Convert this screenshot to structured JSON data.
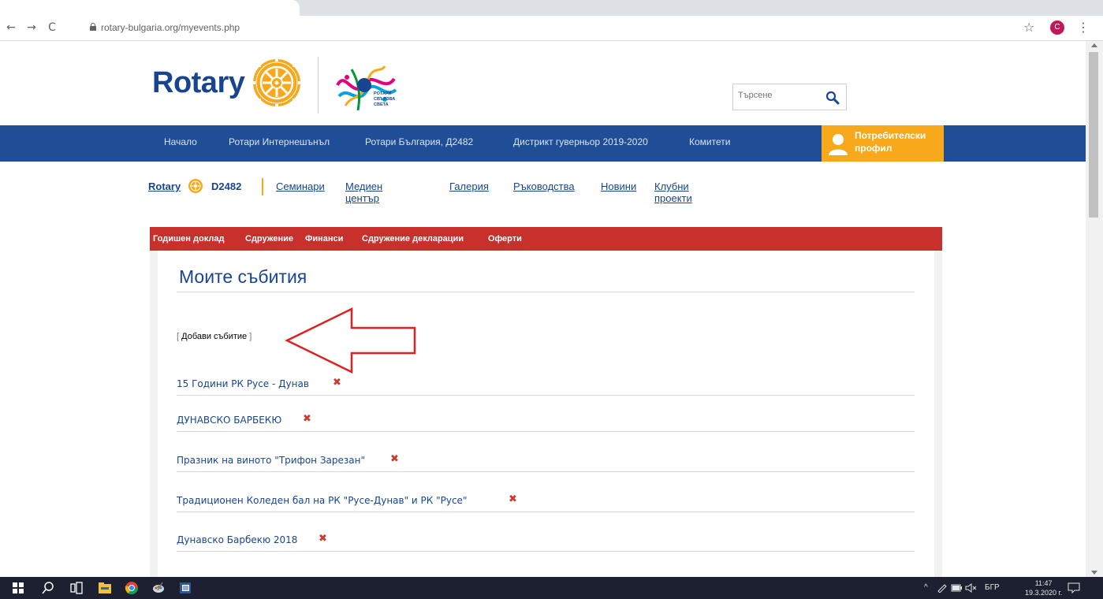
{
  "browser": {
    "url": "rotary-bulgaria.org/myevents.php",
    "profile_initial": "C"
  },
  "header": {
    "logo_text": "Rotary",
    "connect_logo_text": [
      "РОТАРИ",
      "СВЪРЗВА",
      "СВЕТА"
    ],
    "search_placeholder": "Търсене"
  },
  "main_nav": {
    "items": [
      "Начало",
      "Ротари Интернешънъл",
      "Ротари България, Д2482",
      "Дистрикт гуверньор 2019-2020",
      "Комитети"
    ],
    "profile_label_1": "Потребителски",
    "profile_label_2": "профил"
  },
  "district_nav": {
    "brand": "Rotary",
    "code": "D2482",
    "links": [
      "Семинари",
      "Медиен център",
      "Галерия",
      "Ръководства",
      "Новини",
      "Клубни проекти"
    ]
  },
  "sub_nav": {
    "items": [
      "Годишен доклад",
      "Сдружение",
      "Финанси",
      "Сдружение декларации",
      "Оферти"
    ]
  },
  "page": {
    "title": "Моите събития",
    "add_event": "Добави събитие",
    "events": [
      "15 Години РК Русе - Дунав",
      "ДУНАВСКО БАРБЕКЮ",
      "Празник на виното \"Трифон Зарезан\"",
      "Традиционен Коледен бал на РК \"Русе-Дунав\" и РК \"Русе\"",
      "Дунавско Барбекю 2018"
    ],
    "delete_glyph": "✖"
  },
  "taskbar": {
    "language": "БГР",
    "time": "11:47",
    "date": "19.3.2020 г."
  },
  "colors": {
    "rotary_blue": "#17458f",
    "nav_blue": "#1f4e96",
    "gold": "#f7a81b",
    "red_bar": "#c8302c",
    "delete_red": "#d0392b"
  }
}
